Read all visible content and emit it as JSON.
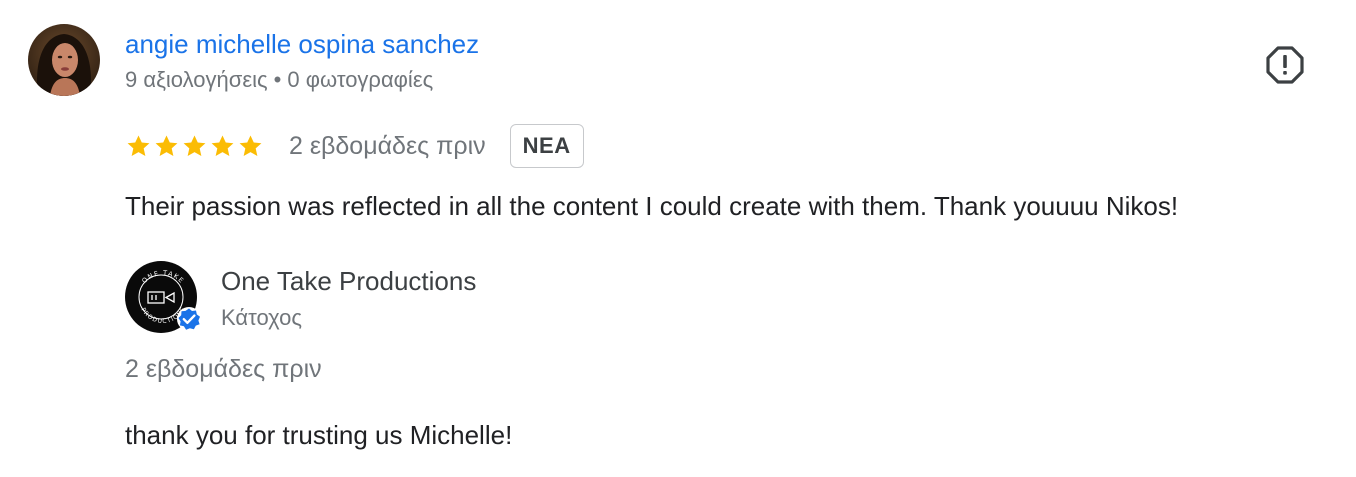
{
  "review": {
    "reviewer": {
      "name": "angie michelle ospina sanchez",
      "reviews_count": "9 αξιολογήσεις",
      "separator": "•",
      "photos_count": "0 φωτογραφίες"
    },
    "rating": {
      "stars": 5,
      "max_stars": 5
    },
    "time": "2 εβδομάδες πριν",
    "badge": "NEA",
    "text": "Their passion was reflected in all the content I could create with them. Thank youuuu Nikos!"
  },
  "owner_reply": {
    "name": "One Take Productions",
    "role": "Κάτοχος",
    "time": "2 εβδομάδες πριν",
    "text": "thank you for trusting us Michelle!",
    "logo_text": "ONE TAKE PRODUCTIONS"
  },
  "icons": {
    "report": "report-flag-icon",
    "star": "star-icon",
    "verified": "verified-check-icon"
  },
  "colors": {
    "link_blue": "#1a73e8",
    "star_gold": "#fbbc04",
    "meta_gray": "#70757a",
    "verified_blue": "#1a73e8"
  }
}
